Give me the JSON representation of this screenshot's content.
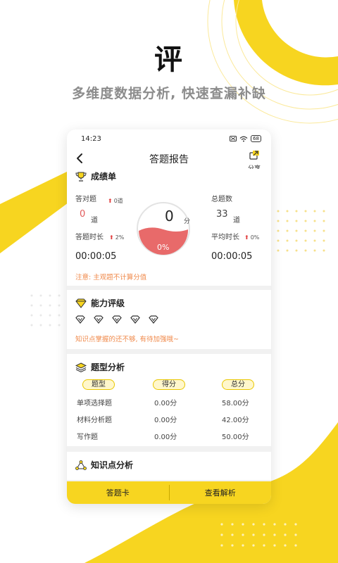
{
  "promo": {
    "big_char": "评",
    "subtitle": "多维度数据分析, 快速查漏补缺"
  },
  "status_bar": {
    "time": "14:23",
    "battery": "68"
  },
  "header": {
    "title": "答题报告",
    "share_label": "分享"
  },
  "score_card": {
    "title": "成绩单",
    "correct_label": "答对题",
    "correct_value": "0",
    "correct_unit": "道",
    "correct_delta": "0道",
    "total_label": "总题数",
    "total_value": "33",
    "total_unit": "道",
    "time_label": "答题时长",
    "time_delta": "2%",
    "time_value": "00:00:05",
    "avg_label": "平均时长",
    "avg_delta": "0%",
    "avg_value": "00:00:05",
    "score_value": "0",
    "score_unit": "分",
    "accuracy": "0%",
    "note": "注意: 主观题不计算分值"
  },
  "ability": {
    "title": "能力评级",
    "rating": 0,
    "max_rating": 5,
    "comment": "知识点掌握的还不够, 有待加强哦~"
  },
  "type_analysis": {
    "title": "题型分析",
    "headers": [
      "题型",
      "得分",
      "总分"
    ],
    "rows": [
      [
        "单项选择题",
        "0.00分",
        "58.00分"
      ],
      [
        "材料分析题",
        "0.00分",
        "42.00分"
      ],
      [
        "写作题",
        "0.00分",
        "50.00分"
      ]
    ]
  },
  "knowledge": {
    "title": "知识点分析"
  },
  "bottom": {
    "answer_card": "答题卡",
    "view_analysis": "查看解析"
  },
  "colors": {
    "accent_yellow": "#f7d520",
    "score_red": "#e86a6a",
    "note_orange": "#f08a4b"
  },
  "icons": [
    "back-arrow-icon",
    "share-icon",
    "trophy-icon",
    "diamond-icon",
    "layers-icon",
    "network-icon",
    "wifi-icon",
    "battery-icon"
  ]
}
